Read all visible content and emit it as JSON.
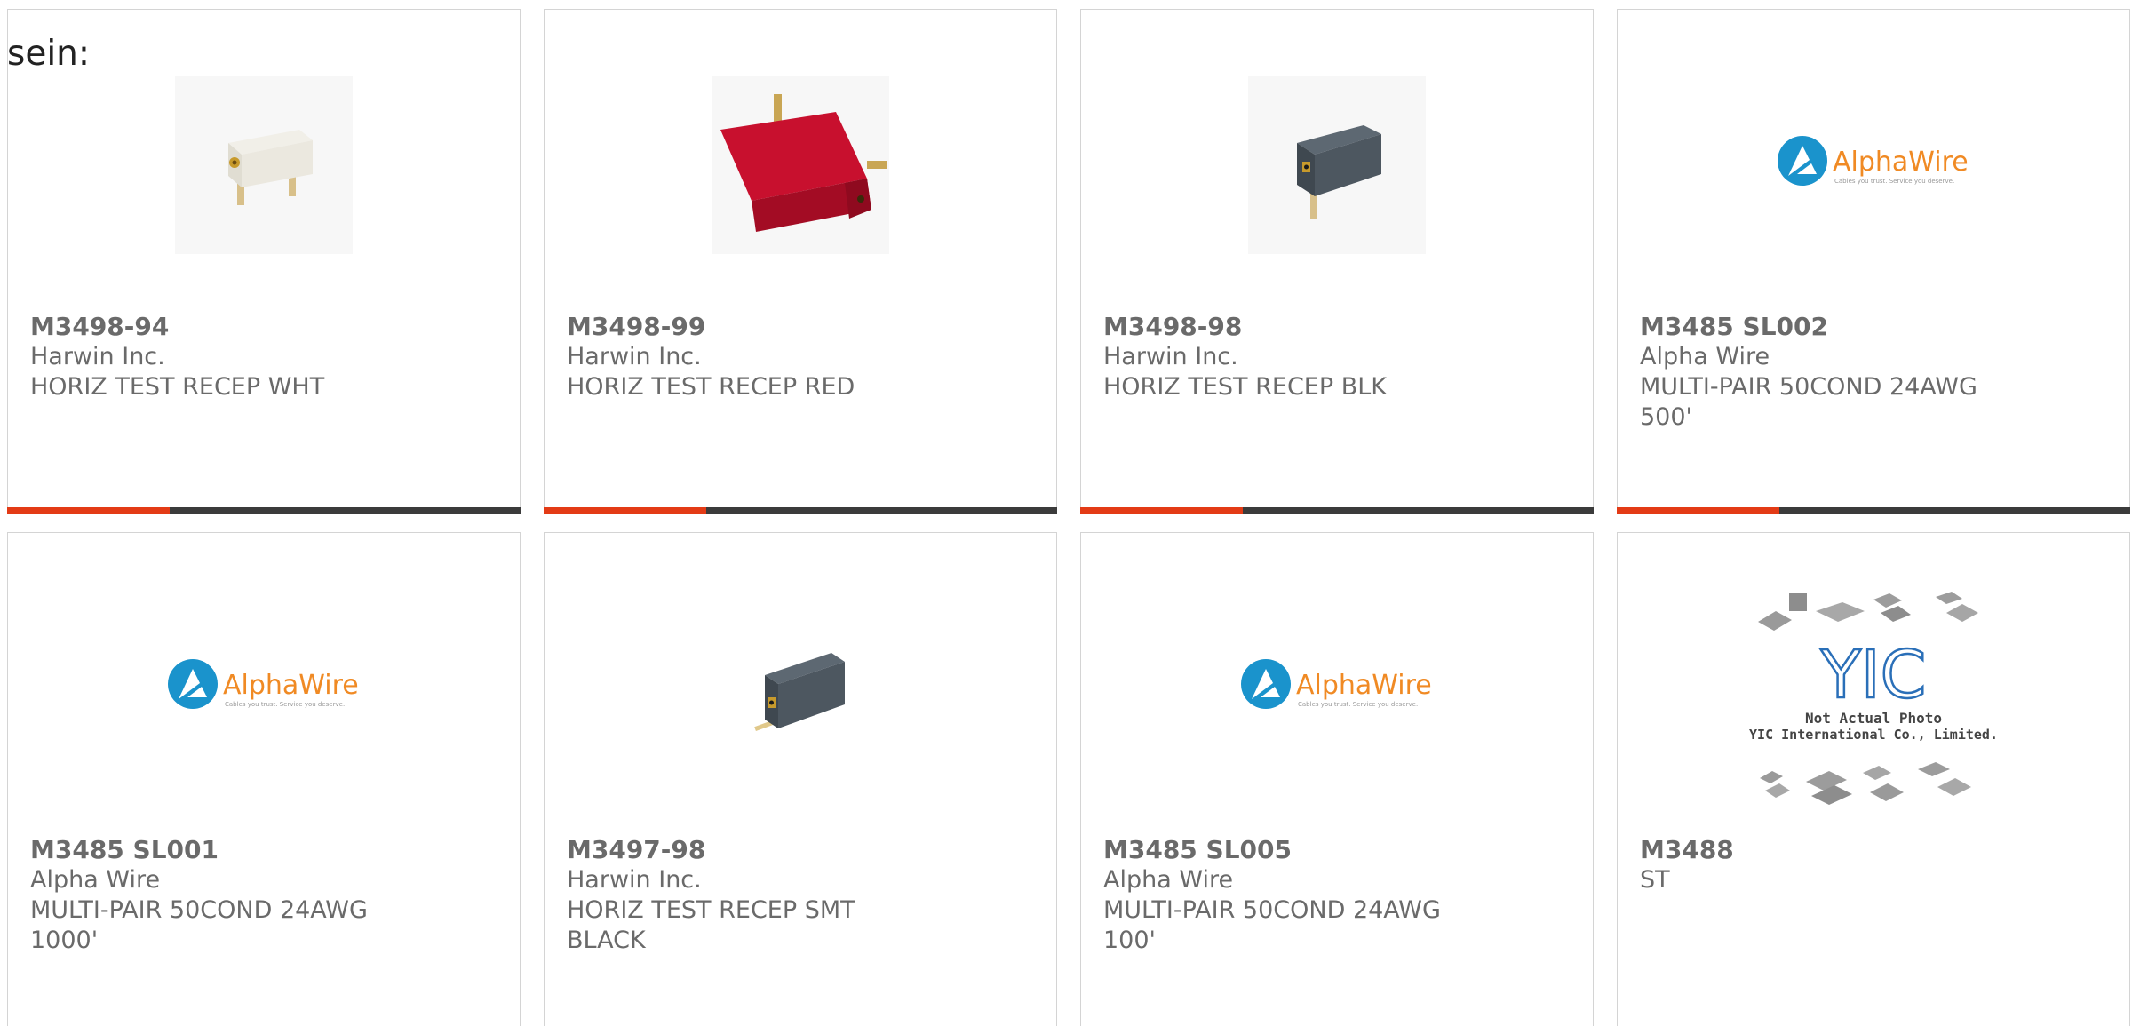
{
  "intro": "sein:",
  "colors": {
    "accent": "#e33b16",
    "bar": "#3b3b3b",
    "text": "#6a6a6a",
    "border": "#d4d4d4",
    "alpha_blue": "#1a93cc",
    "alpha_orange": "#f08a24"
  },
  "products": [
    {
      "part": "M3498-94",
      "maker": "Harwin Inc.",
      "desc": "HORIZ TEST RECEP WHT",
      "image": "white-test-receptacle"
    },
    {
      "part": "M3498-99",
      "maker": "Harwin Inc.",
      "desc": "HORIZ TEST RECEP RED",
      "image": "red-test-receptacle"
    },
    {
      "part": "M3498-98",
      "maker": "Harwin Inc.",
      "desc": "HORIZ TEST RECEP BLK",
      "image": "black-test-receptacle"
    },
    {
      "part": "M3485 SL002",
      "maker": "Alpha Wire",
      "desc": "MULTI-PAIR 50COND 24AWG 500'",
      "image": "alphawire-logo"
    },
    {
      "part": "M3485 SL001",
      "maker": "Alpha Wire",
      "desc": "MULTI-PAIR 50COND 24AWG 1000'",
      "image": "alphawire-logo"
    },
    {
      "part": "M3497-98",
      "maker": "Harwin Inc.",
      "desc": "HORIZ TEST RECEP SMT BLACK",
      "image": "black-smt-receptacle"
    },
    {
      "part": "M3485 SL005",
      "maker": "Alpha Wire",
      "desc": "MULTI-PAIR 50COND 24AWG 100'",
      "image": "alphawire-logo"
    },
    {
      "part": "M3488",
      "maker": "ST",
      "desc": "",
      "image": "yic-not-actual-photo"
    }
  ],
  "logos": {
    "alphawire_name": "AlphaWire",
    "alphawire_tagline": "Cables you trust. Service you deserve.",
    "yic_mark": "YIC",
    "yic_line1": "Not Actual Photo",
    "yic_line2": "YIC International Co., Limited."
  }
}
